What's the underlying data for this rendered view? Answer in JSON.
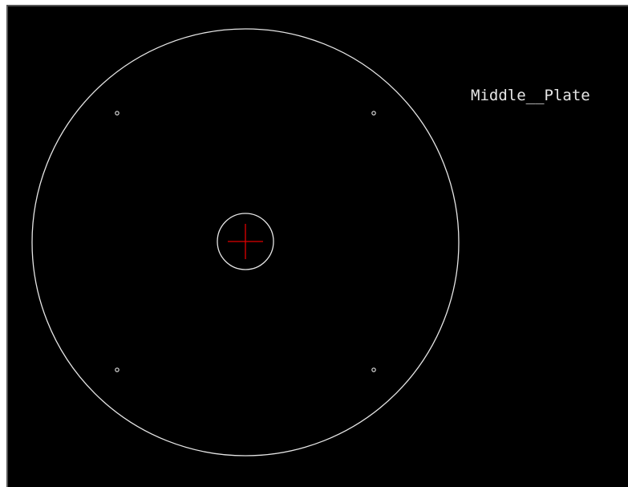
{
  "drawing": {
    "part_label": "Middle__Plate",
    "colors": {
      "background": "#000000",
      "outline": "#e6e6e6",
      "crosshair": "#e00000",
      "label": "#e6e6e6"
    }
  }
}
